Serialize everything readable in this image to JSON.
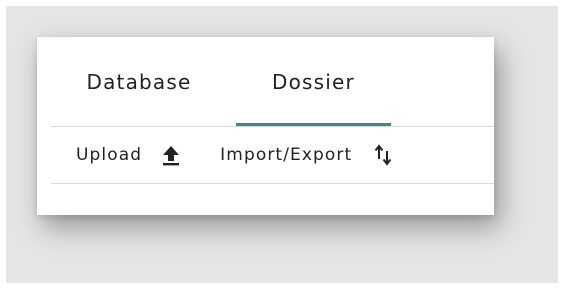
{
  "tabs": {
    "items": [
      {
        "label": "Database"
      },
      {
        "label": "Dossier"
      }
    ],
    "active": "Dossier"
  },
  "toolbar": {
    "upload_label": "Upload",
    "upload_icon": "upload-icon",
    "import_export_label": "Import/Export",
    "import_export_icon": "sort-arrows-icon"
  },
  "colors": {
    "accent": "#3d8a84",
    "background": "#e5e5e5",
    "card": "#ffffff",
    "text": "#222222"
  }
}
